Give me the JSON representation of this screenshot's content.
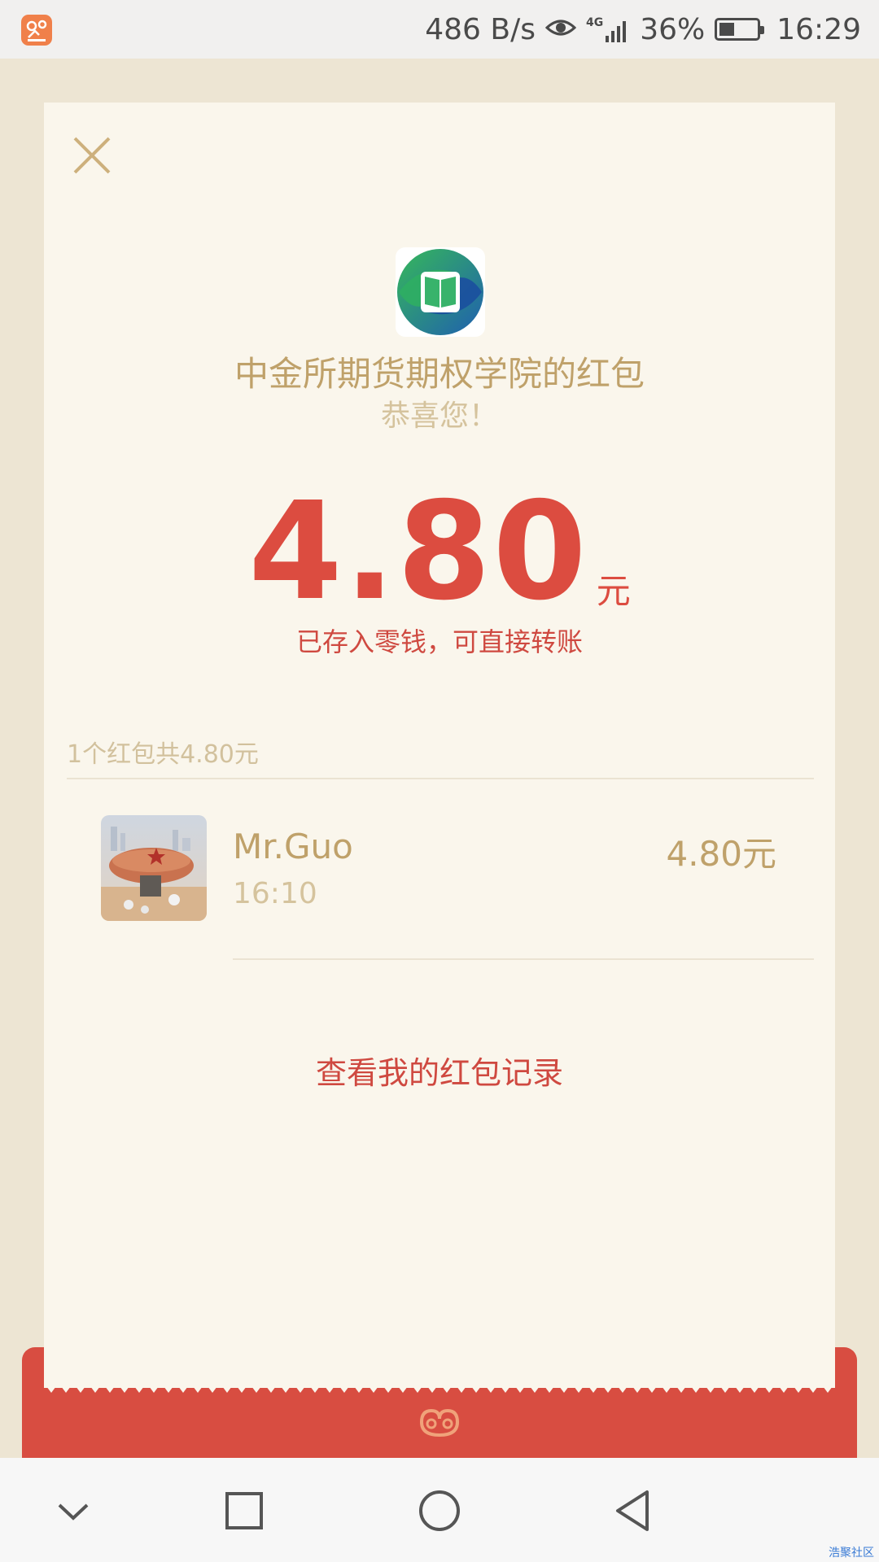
{
  "status_bar": {
    "net_speed": "486 B/s",
    "network": "4G",
    "battery": "36%",
    "battery_level": 0.36,
    "time": "16:29"
  },
  "card": {
    "sender": "中金所期货期权学院的红包",
    "greeting": "恭喜您！",
    "amount": "4.80",
    "amount_unit": "元",
    "saved_note": "已存入零钱，可直接转账",
    "summary": "1个红包共4.80元",
    "recipients": [
      {
        "name": "Mr.Guo",
        "time": "16:10",
        "amount": "4.80元"
      }
    ],
    "history_link": "查看我的红包记录"
  },
  "colors": {
    "accent_red": "#dc4c40",
    "gold_text": "#bfa16a",
    "card_bg": "#faf6ec",
    "page_bg": "#ede5d3"
  },
  "watermark": "浩聚社区"
}
